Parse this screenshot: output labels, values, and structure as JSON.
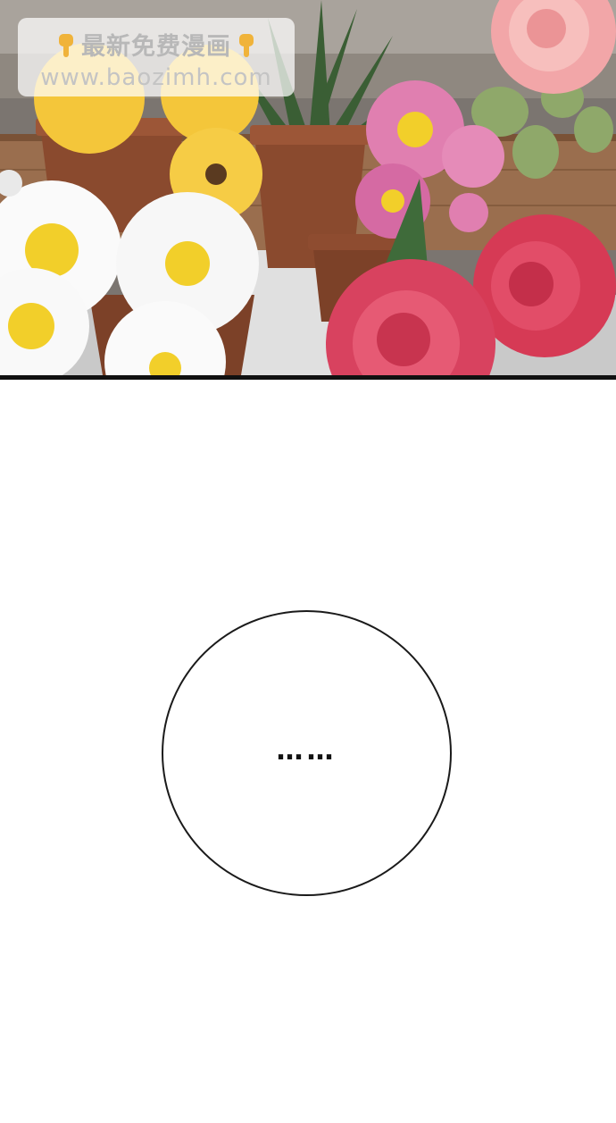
{
  "watermark": {
    "line1": "最新免费漫画",
    "line2": "www.baozimh.com",
    "icon": "pointing-down-hand-icon"
  },
  "bubble": {
    "text": "……"
  },
  "colors": {
    "background": "#ffffff",
    "rose_red": "#d63a55",
    "rose_pink": "#f2a6a8",
    "daisy_white": "#fafafa",
    "daisy_center": "#f2cf2a",
    "yellow_flower": "#f4c63a",
    "pot_brown": "#8a4a2e",
    "leaf_green": "#3f6b3a"
  }
}
